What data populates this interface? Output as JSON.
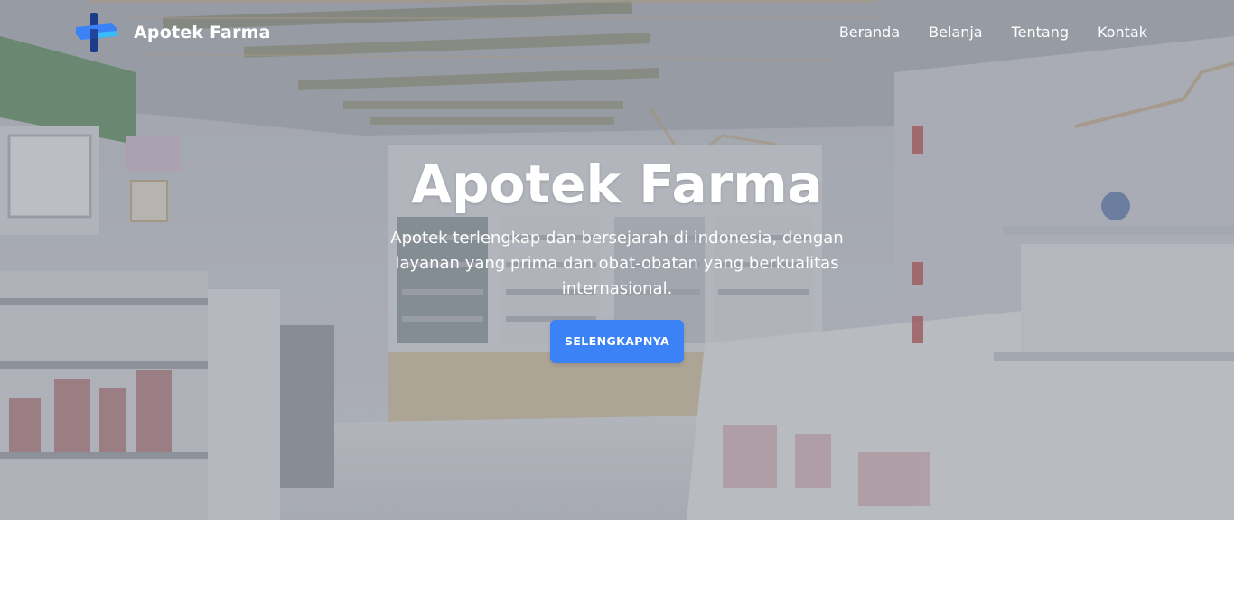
{
  "brand": {
    "name": "Apotek Farma",
    "logo_icon": "medical-cross-icon",
    "logo_colors": [
      "#3b82f6",
      "#1e3a8a",
      "#38bdf8"
    ]
  },
  "nav": {
    "items": [
      {
        "label": "Beranda"
      },
      {
        "label": "Belanja"
      },
      {
        "label": "Tentang"
      },
      {
        "label": "Kontak"
      }
    ]
  },
  "hero": {
    "title": "Apotek Farma",
    "description": "Apotek terlengkap dan bersejarah di indonesia, dengan layanan yang prima dan obat-obatan yang berkualitas internasional.",
    "cta_label": "SELENGKAPNYA",
    "background": "pharmacy-store-interior-photo"
  },
  "colors": {
    "accent": "#3b82f6",
    "overlay": "#646876",
    "text": "#ffffff"
  }
}
